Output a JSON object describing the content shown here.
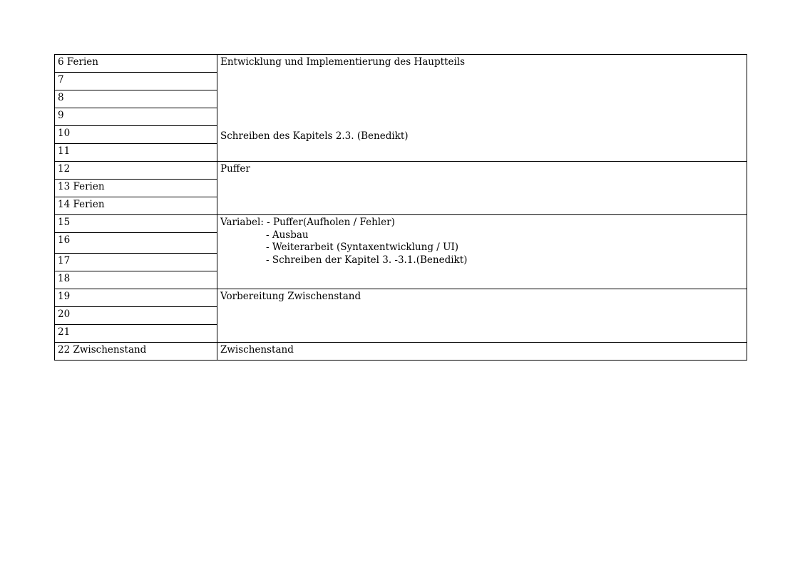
{
  "weeks": [
    {
      "label": "6 Ferien"
    },
    {
      "label": "7"
    },
    {
      "label": "8"
    },
    {
      "label": "9"
    },
    {
      "label": "10"
    },
    {
      "label": "11"
    },
    {
      "label": "12"
    },
    {
      "label": "13 Ferien"
    },
    {
      "label": "14 Ferien"
    },
    {
      "label": "15"
    },
    {
      "label": "16"
    },
    {
      "label": "17"
    },
    {
      "label": "18"
    },
    {
      "label": "19"
    },
    {
      "label": "20"
    },
    {
      "label": "21"
    },
    {
      "label": "22 Zwischenstand"
    }
  ],
  "tasks": {
    "block1_title": "Entwicklung und Implementierung des Hauptteils",
    "block1_note": "Schreiben des Kapitels 2.3. (Benedikt)",
    "block2_title": "Puffer",
    "block3_line1": "Variabel: - Puffer(Aufholen / Fehler)",
    "block3_line2": "- Ausbau",
    "block3_line3": "- Weiterarbeit (Syntaxentwicklung / UI)",
    "block3_line4": "- Schreiben der Kapitel 3. -3.1.(Benedikt)",
    "block4_title": "Vorbereitung Zwischenstand",
    "block5_title": "Zwischenstand"
  }
}
